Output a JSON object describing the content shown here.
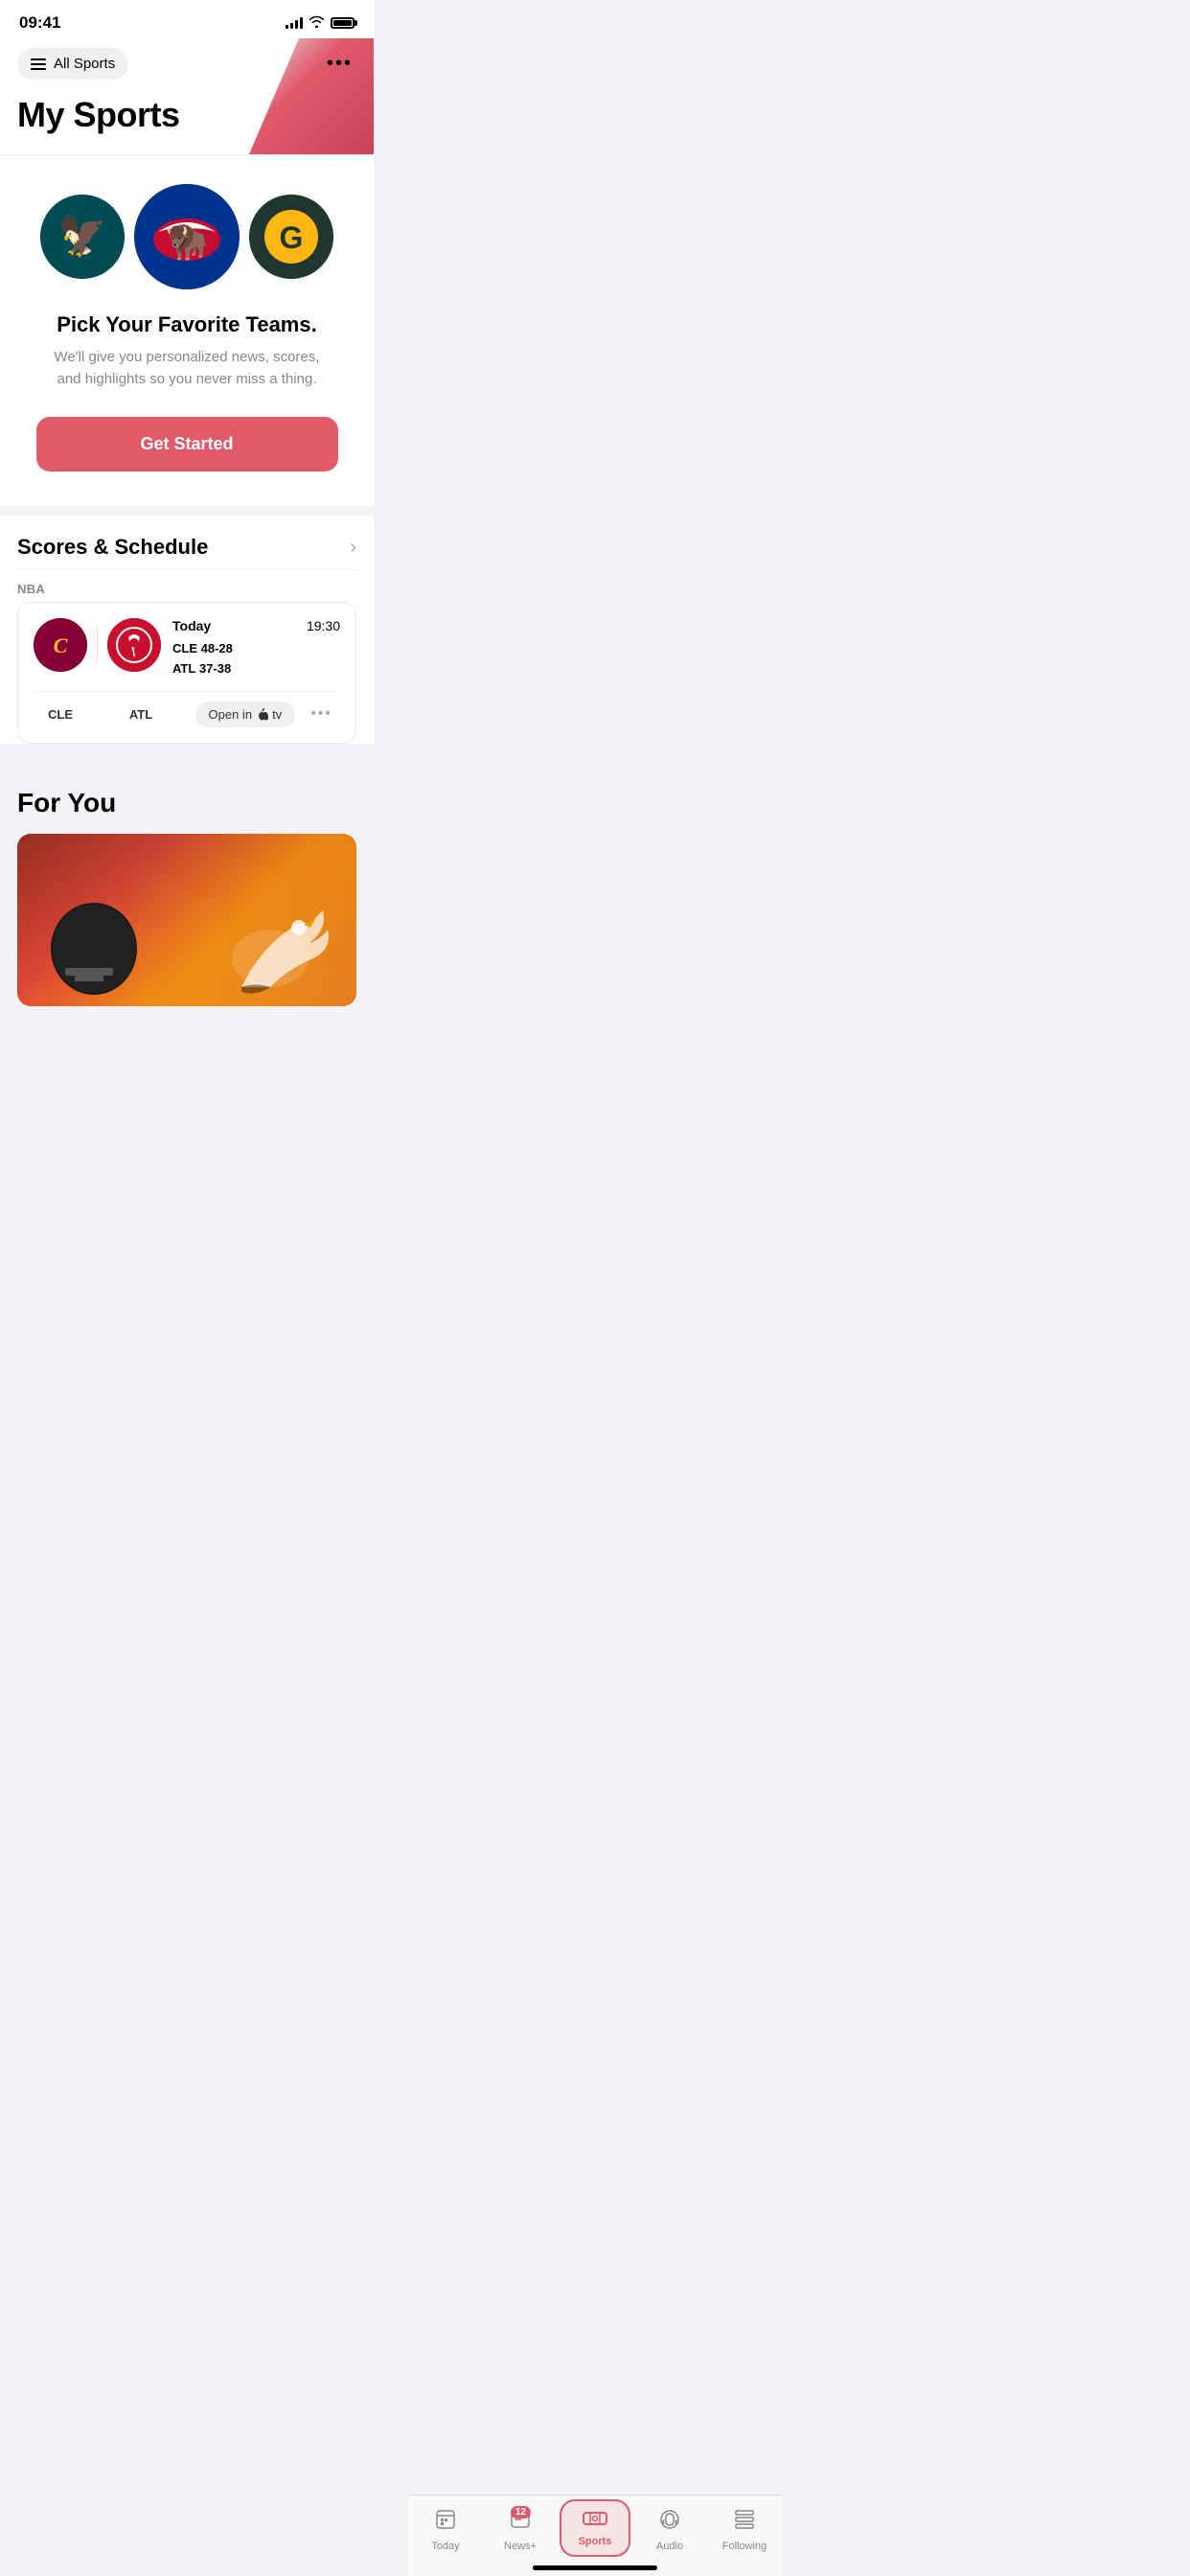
{
  "statusBar": {
    "time": "09:41",
    "signalBars": [
      4,
      6,
      8,
      10,
      12
    ],
    "batteryFull": true
  },
  "header": {
    "allSportsLabel": "All Sports",
    "moreDotsLabel": "•••",
    "pageTitle": "My Sports"
  },
  "teamsSection": {
    "teams": [
      {
        "name": "Eagles",
        "abbr": "PHI",
        "bg": "#004C54",
        "size": "small"
      },
      {
        "name": "Bills",
        "abbr": "BUF",
        "bg": "#00338D",
        "size": "large"
      },
      {
        "name": "Packers",
        "abbr": "GB",
        "bg": "#203731",
        "size": "small"
      }
    ],
    "pickTitle": "Pick Your Favorite Teams.",
    "pickSubtitle": "We'll give you personalized news, scores, and highlights so you never miss a thing.",
    "getStartedLabel": "Get Started"
  },
  "scoresSection": {
    "title": "Scores & Schedule",
    "league": "NBA",
    "game": {
      "date": "Today",
      "time": "19:30",
      "team1": {
        "abbr": "CLE",
        "record": "48-28",
        "bg": "#860038"
      },
      "team2": {
        "abbr": "ATL",
        "record": "37-38",
        "bg": "#c8102e"
      },
      "openInLabel": "Open in",
      "appleTV": "tv",
      "moreLabel": "•••"
    }
  },
  "forYouSection": {
    "title": "For You"
  },
  "tabBar": {
    "tabs": [
      {
        "id": "today",
        "label": "Today",
        "icon": "today",
        "active": false,
        "badge": null
      },
      {
        "id": "newsplus",
        "label": "News+",
        "icon": "newsplus",
        "active": false,
        "badge": "12"
      },
      {
        "id": "sports",
        "label": "Sports",
        "icon": "sports",
        "active": true,
        "badge": null
      },
      {
        "id": "audio",
        "label": "Audio",
        "icon": "audio",
        "active": false,
        "badge": null
      },
      {
        "id": "following",
        "label": "Following",
        "icon": "following",
        "active": false,
        "badge": null
      }
    ]
  }
}
